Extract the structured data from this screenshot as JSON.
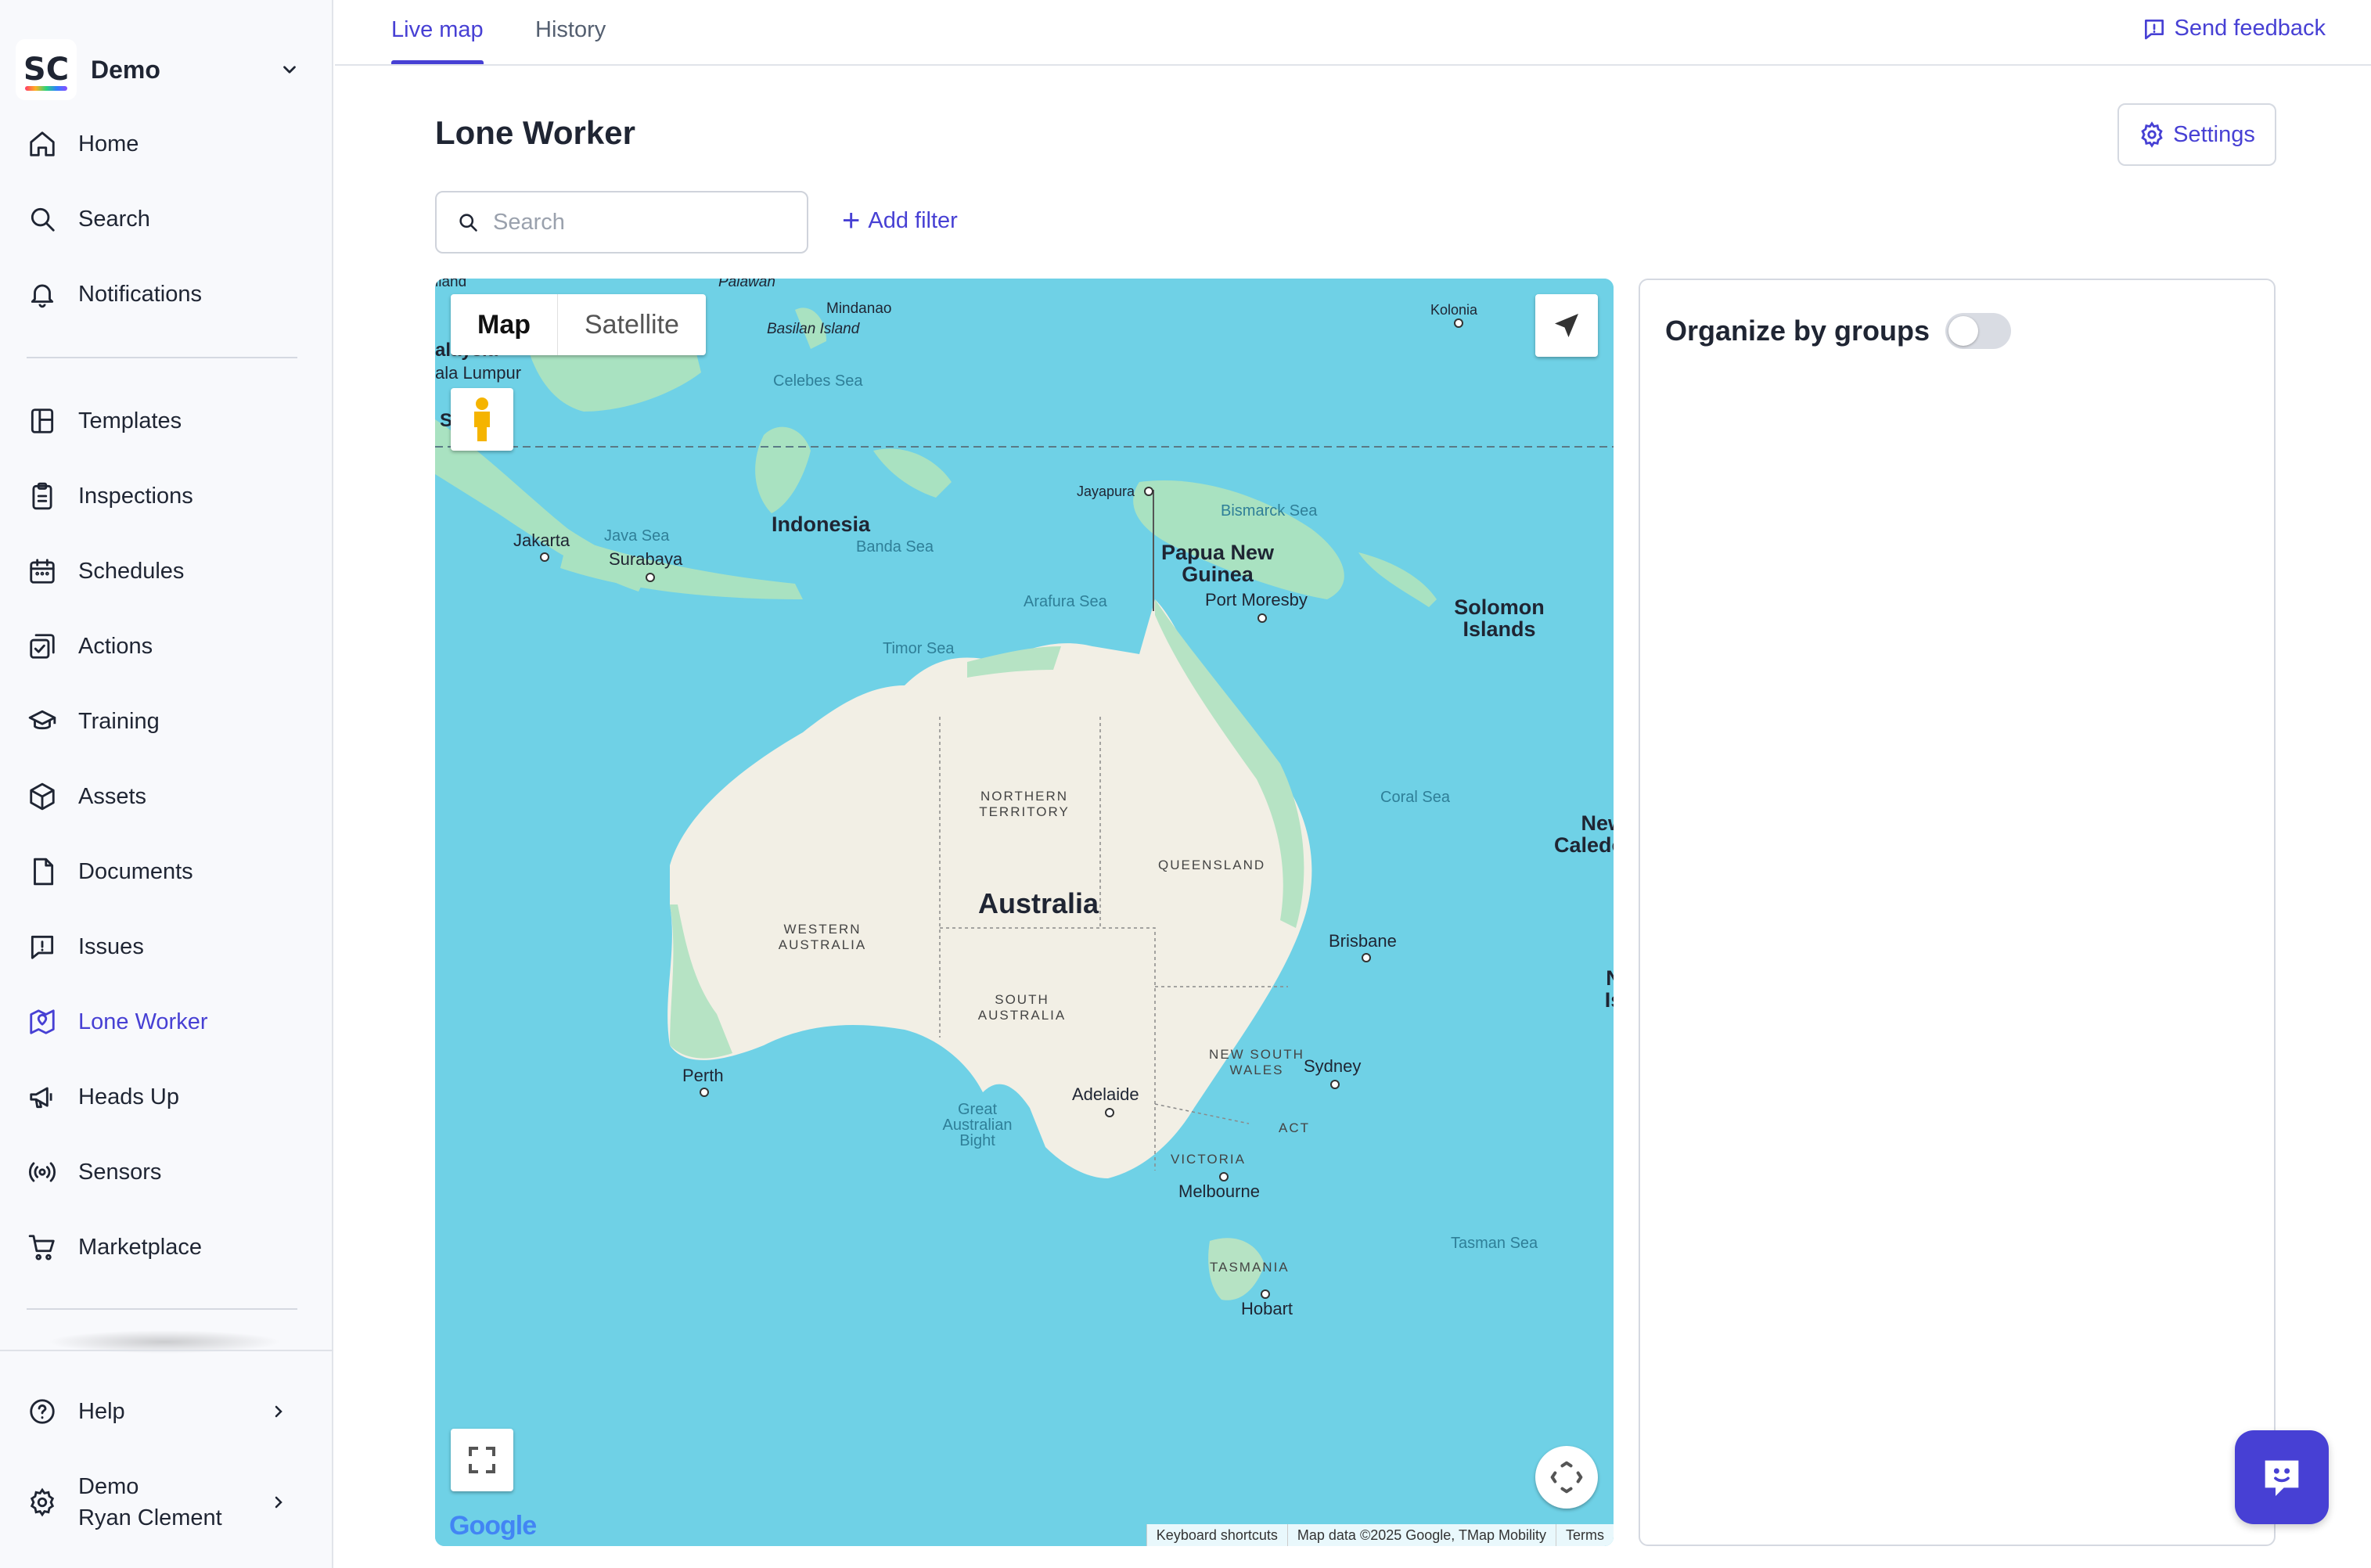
{
  "org": {
    "name": "Demo",
    "logo_text": "SC"
  },
  "sidebar": {
    "items": [
      {
        "label": "Home",
        "icon": "home-icon"
      },
      {
        "label": "Search",
        "icon": "search-icon"
      },
      {
        "label": "Notifications",
        "icon": "bell-icon"
      },
      {
        "label": "Templates",
        "icon": "template-icon"
      },
      {
        "label": "Inspections",
        "icon": "clipboard-icon"
      },
      {
        "label": "Schedules",
        "icon": "calendar-icon"
      },
      {
        "label": "Actions",
        "icon": "actions-icon"
      },
      {
        "label": "Training",
        "icon": "graduation-cap-icon"
      },
      {
        "label": "Assets",
        "icon": "cube-icon"
      },
      {
        "label": "Documents",
        "icon": "document-icon"
      },
      {
        "label": "Issues",
        "icon": "alert-icon"
      },
      {
        "label": "Lone Worker",
        "icon": "map-pin-icon"
      },
      {
        "label": "Heads Up",
        "icon": "megaphone-icon"
      },
      {
        "label": "Sensors",
        "icon": "sensor-icon"
      },
      {
        "label": "Marketplace",
        "icon": "cart-icon"
      }
    ],
    "active": "Lone Worker",
    "help_label": "Help",
    "user": {
      "org": "Demo",
      "name": "Ryan Clement"
    }
  },
  "tabs": [
    {
      "label": "Live map",
      "active": true
    },
    {
      "label": "History",
      "active": false
    }
  ],
  "feedback_label": "Send feedback",
  "page_title": "Lone Worker",
  "settings_label": "Settings",
  "search": {
    "placeholder": "Search",
    "value": ""
  },
  "add_filter_label": "Add filter",
  "map": {
    "type_options": [
      "Map",
      "Satellite"
    ],
    "selected_type": "Map",
    "labels": {
      "australia": "Australia",
      "indonesia": "Indonesia",
      "png": "Papua New Guinea",
      "solomon": "Solomon Islands",
      "new_caledonia": "New Caledo",
      "western_australia": "WESTERN AUSTRALIA",
      "northern_territory": "NORTHERN TERRITORY",
      "queensland": "QUEENSLAND",
      "south_australia": "SOUTH AUSTRALIA",
      "nsw": "NEW SOUTH WALES",
      "victoria": "VICTORIA",
      "tasmania": "TASMANIA",
      "act": "ACT",
      "perth": "Perth",
      "adelaide": "Adelaide",
      "melbourne": "Melbourne",
      "sydney": "Sydney",
      "brisbane": "Brisbane",
      "hobart": "Hobart",
      "jakarta": "Jakarta",
      "surabaya": "Surabaya",
      "port_moresby": "Port Moresby",
      "jayapura": "Jayapura",
      "kolonia": "Kolonia",
      "mindanao": "Mindanao",
      "basilan": "Basilan Island",
      "palawan": "Palawan",
      "kuala_lumpur": "ala Lumpur",
      "malaysia": "alaysia",
      "singapore": "S     ore",
      "celebes_sea": "Celebes Sea",
      "java_sea": "Java Sea",
      "banda_sea": "Banda Sea",
      "arafura_sea": "Arafura Sea",
      "timor_sea": "Timor Sea",
      "bismarck_sea": "Bismarck Sea",
      "coral_sea": "Coral Sea",
      "tasman_sea": "Tasman Sea",
      "bight": "Great Australian Bight",
      "n_is": "N Is",
      "island": "iland"
    },
    "google_logo": "Google",
    "attribution": {
      "shortcuts": "Keyboard shortcuts",
      "data": "Map data ©2025 Google, TMap Mobility",
      "terms": "Terms"
    }
  },
  "panel": {
    "title": "Organize by groups",
    "toggle_on": false
  },
  "colors": {
    "accent": "#4740d4",
    "water": "#6fd1e6",
    "land": "#f2efe5",
    "vegetation": "#b6e3c4"
  }
}
